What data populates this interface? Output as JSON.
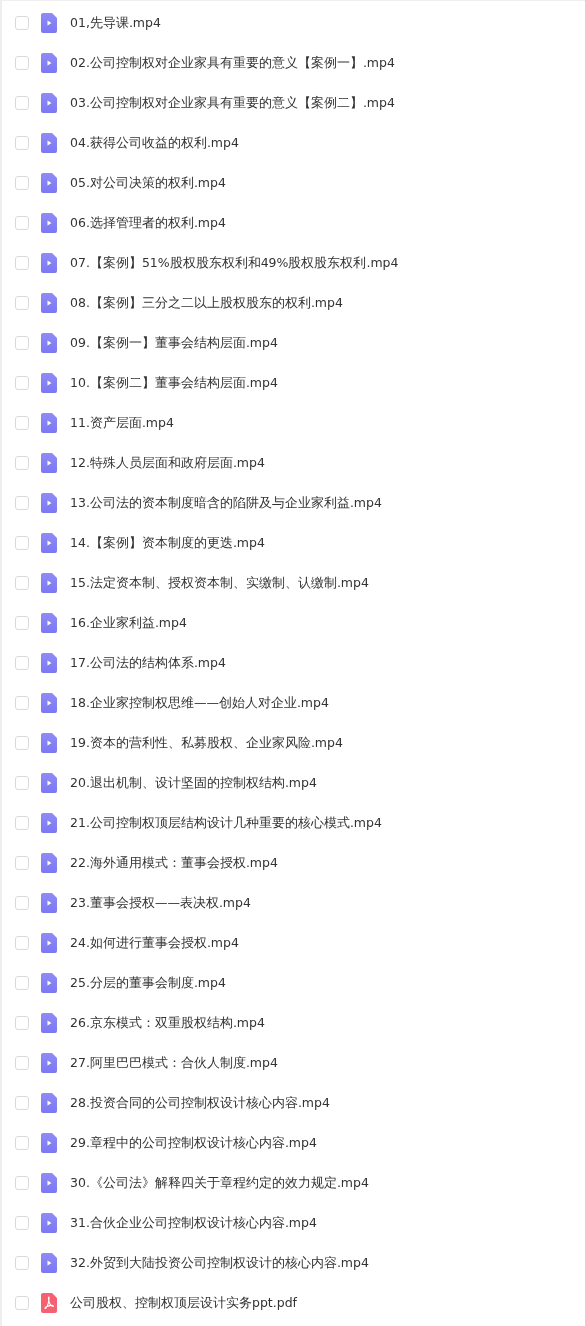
{
  "files": [
    {
      "name": "01,先导课.mp4",
      "kind": "video",
      "checked": false
    },
    {
      "name": "02.公司控制权对企业家具有重要的意义【案例一】.mp4",
      "kind": "video",
      "checked": false
    },
    {
      "name": "03.公司控制权对企业家具有重要的意义【案例二】.mp4",
      "kind": "video",
      "checked": false
    },
    {
      "name": "04.获得公司收益的权利.mp4",
      "kind": "video",
      "checked": false
    },
    {
      "name": "05.对公司决策的权利.mp4",
      "kind": "video",
      "checked": false
    },
    {
      "name": "06.选择管理者的权利.mp4",
      "kind": "video",
      "checked": false
    },
    {
      "name": "07.【案例】51%股权股东权利和49%股权股东权利.mp4",
      "kind": "video",
      "checked": false
    },
    {
      "name": "08.【案例】三分之二以上股权股东的权利.mp4",
      "kind": "video",
      "checked": false
    },
    {
      "name": "09.【案例一】董事会结构层面.mp4",
      "kind": "video",
      "checked": false
    },
    {
      "name": "10.【案例二】董事会结构层面.mp4",
      "kind": "video",
      "checked": false
    },
    {
      "name": "11.资产层面.mp4",
      "kind": "video",
      "checked": false
    },
    {
      "name": "12.特殊人员层面和政府层面.mp4",
      "kind": "video",
      "checked": false
    },
    {
      "name": "13.公司法的资本制度暗含的陷阱及与企业家利益.mp4",
      "kind": "video",
      "checked": false
    },
    {
      "name": "14.【案例】资本制度的更迭.mp4",
      "kind": "video",
      "checked": false
    },
    {
      "name": "15.法定资本制、授权资本制、实缴制、认缴制.mp4",
      "kind": "video",
      "checked": false
    },
    {
      "name": "16.企业家利益.mp4",
      "kind": "video",
      "checked": false
    },
    {
      "name": "17.公司法的结构体系.mp4",
      "kind": "video",
      "checked": false
    },
    {
      "name": "18.企业家控制权思维——创始人对企业.mp4",
      "kind": "video",
      "checked": false
    },
    {
      "name": "19.资本的营利性、私募股权、企业家风险.mp4",
      "kind": "video",
      "checked": false
    },
    {
      "name": "20.退出机制、设计坚固的控制权结构.mp4",
      "kind": "video",
      "checked": false
    },
    {
      "name": "21.公司控制权顶层结构设计几种重要的核心模式.mp4",
      "kind": "video",
      "checked": false
    },
    {
      "name": "22.海外通用模式：董事会授权.mp4",
      "kind": "video",
      "checked": false
    },
    {
      "name": "23.董事会授权——表决权.mp4",
      "kind": "video",
      "checked": false
    },
    {
      "name": "24.如何进行董事会授权.mp4",
      "kind": "video",
      "checked": false
    },
    {
      "name": "25.分层的董事会制度.mp4",
      "kind": "video",
      "checked": false
    },
    {
      "name": "26.京东模式：双重股权结构.mp4",
      "kind": "video",
      "checked": false
    },
    {
      "name": "27.阿里巴巴模式：合伙人制度.mp4",
      "kind": "video",
      "checked": false
    },
    {
      "name": "28.投资合同的公司控制权设计核心内容.mp4",
      "kind": "video",
      "checked": false
    },
    {
      "name": "29.章程中的公司控制权设计核心内容.mp4",
      "kind": "video",
      "checked": false
    },
    {
      "name": "30.《公司法》解释四关于章程约定的效力规定.mp4",
      "kind": "video",
      "checked": false
    },
    {
      "name": "31.合伙企业公司控制权设计核心内容.mp4",
      "kind": "video",
      "checked": false
    },
    {
      "name": "32.外贸到大陆投资公司控制权设计的核心内容.mp4",
      "kind": "video",
      "checked": false
    },
    {
      "name": "公司股权、控制权顶层设计实务ppt.pdf",
      "kind": "pdf",
      "checked": false
    }
  ]
}
